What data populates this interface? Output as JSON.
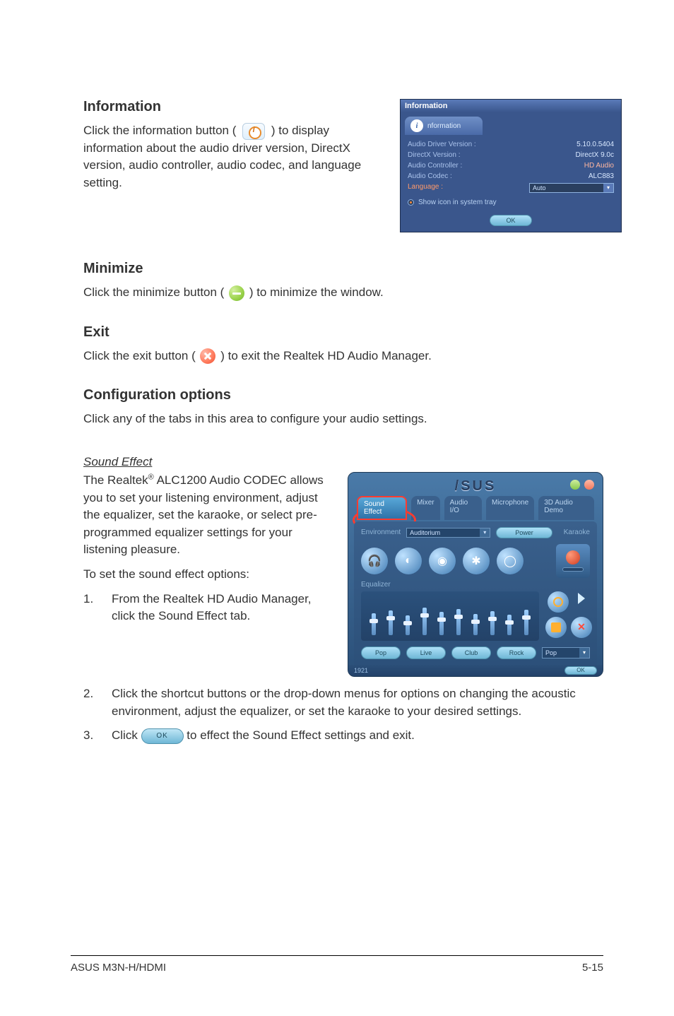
{
  "sections": {
    "info": {
      "title": "Information",
      "text_pre": "Click the information button (",
      "text_post": ") to display information about the audio driver version, DirectX version, audio controller, audio codec, and language setting."
    },
    "minimize": {
      "title": "Minimize",
      "text_pre": "Click the minimize button (",
      "text_post": ") to minimize the window."
    },
    "exit": {
      "title": "Exit",
      "text_pre": "Click the exit button (",
      "text_post": ") to exit the Realtek HD Audio Manager."
    },
    "config": {
      "title": "Configuration options",
      "intro": "Click any of the tabs in this area to configure your audio settings."
    },
    "sound_effect": {
      "heading": "Sound Effect",
      "para_pre": "The Realtek",
      "para_sup": "®",
      "para_post": " ALC1200 Audio CODEC allows you to set your listening environment, adjust the equalizer, set the karaoke, or select pre-programmed equalizer settings for your listening pleasure.",
      "toset": "To set the sound effect options:",
      "steps": {
        "s1": "From the Realtek HD Audio Manager, click the Sound Effect tab.",
        "s2": "Click the shortcut buttons or the drop-down menus for options on changing the acoustic environment, adjust the equalizer, or set the karaoke to your desired settings.",
        "s3_pre": "Click ",
        "s3_post": " to effect the Sound Effect settings and exit.",
        "n1": "1.",
        "n2": "2.",
        "n3": "3."
      }
    }
  },
  "info_panel": {
    "title": "Information",
    "tab": "nformation",
    "rows": {
      "r1l": "Audio Driver Version :",
      "r1v": "5.10.0.5404",
      "r2l": "DirectX Version :",
      "r2v": "DirectX 9.0c",
      "r3l": "Audio Controller :",
      "r3v": "HD Audio",
      "r4l": "Audio Codec :",
      "r4v": "ALC883",
      "r5l": "Language :",
      "r5sel": "Auto"
    },
    "radio": "Show icon in system tray",
    "ok": "OK"
  },
  "se_panel": {
    "logo": "/SUS",
    "tabs": {
      "t1": "Sound Effect",
      "t2": "Mixer",
      "t3": "Audio I/O",
      "t4": "Microphone",
      "t5": "3D Audio Demo"
    },
    "env_label": "Environment",
    "env2_label": "Auditorium",
    "power": "Power",
    "karaoke": "Karaoke",
    "eq": "Equalizer",
    "btns": {
      "b1": "Pop",
      "b2": "Live",
      "b3": "Club",
      "b4": "Rock"
    },
    "presetsel": "Pop",
    "ok": "OK",
    "footer_left": "1921"
  },
  "ok_btn_inline": "OK",
  "footer": {
    "left": "ASUS M3N-H/HDMI",
    "right": "5-15"
  }
}
